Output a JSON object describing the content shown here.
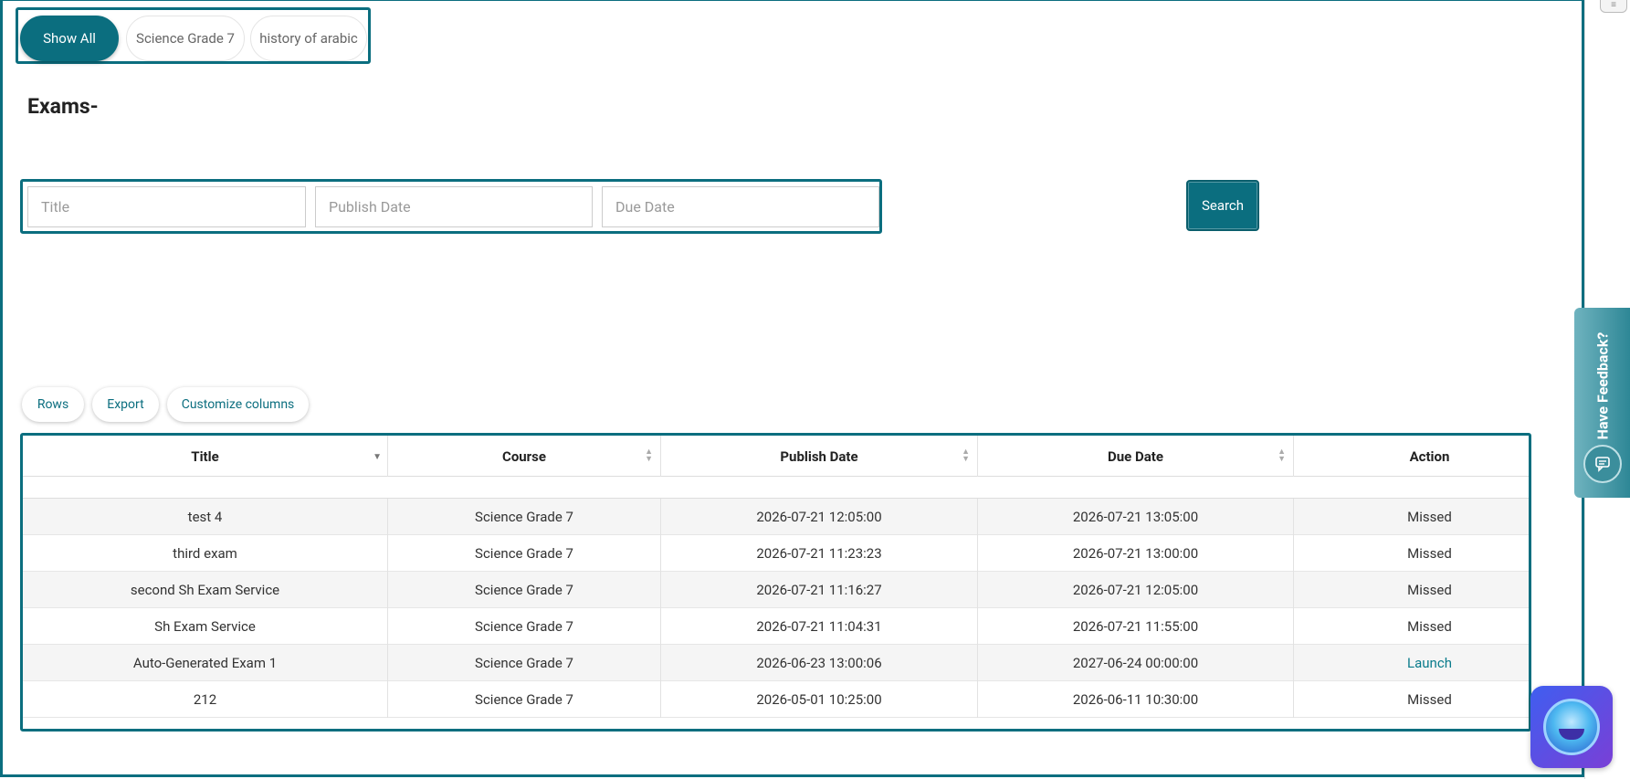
{
  "filters": {
    "items": [
      {
        "label": "Show All"
      },
      {
        "label": "Science Grade 7"
      },
      {
        "label": "history of arabic"
      }
    ]
  },
  "page_title": "Exams-",
  "search": {
    "title_placeholder": "Title",
    "publish_placeholder": "Publish Date",
    "due_placeholder": "Due Date",
    "button_label": "Search"
  },
  "toolbar": {
    "rows_label": "Rows",
    "export_label": "Export",
    "customize_label": "Customize columns"
  },
  "table": {
    "columns": [
      "Title",
      "Course",
      "Publish Date",
      "Due Date",
      "Action"
    ],
    "rows": [
      {
        "title": "test 4",
        "course": "Science Grade 7",
        "publish": "2026-07-21 12:05:00",
        "due": "2026-07-21 13:05:00",
        "action": "Missed"
      },
      {
        "title": "third exam",
        "course": "Science Grade 7",
        "publish": "2026-07-21 11:23:23",
        "due": "2026-07-21 13:00:00",
        "action": "Missed"
      },
      {
        "title": "second Sh Exam Service",
        "course": "Science Grade 7",
        "publish": "2026-07-21 11:16:27",
        "due": "2026-07-21 12:05:00",
        "action": "Missed"
      },
      {
        "title": "Sh Exam Service",
        "course": "Science Grade 7",
        "publish": "2026-07-21 11:04:31",
        "due": "2026-07-21 11:55:00",
        "action": "Missed"
      },
      {
        "title": "Auto-Generated Exam 1",
        "course": "Science Grade 7",
        "publish": "2026-06-23 13:00:06",
        "due": "2027-06-24 00:00:00",
        "action": "Launch"
      },
      {
        "title": "212",
        "course": "Science Grade 7",
        "publish": "2026-05-01 10:25:00",
        "due": "2026-06-11 10:30:00",
        "action": "Missed"
      }
    ]
  },
  "feedback": {
    "label": "Have Feedback?"
  },
  "icons": {
    "feedback": "chat-icon",
    "assistant": "assistant-avatar-icon",
    "corner": "menu-icon"
  },
  "colors": {
    "accent": "#0b6e7f",
    "link": "#0b7c8c"
  }
}
